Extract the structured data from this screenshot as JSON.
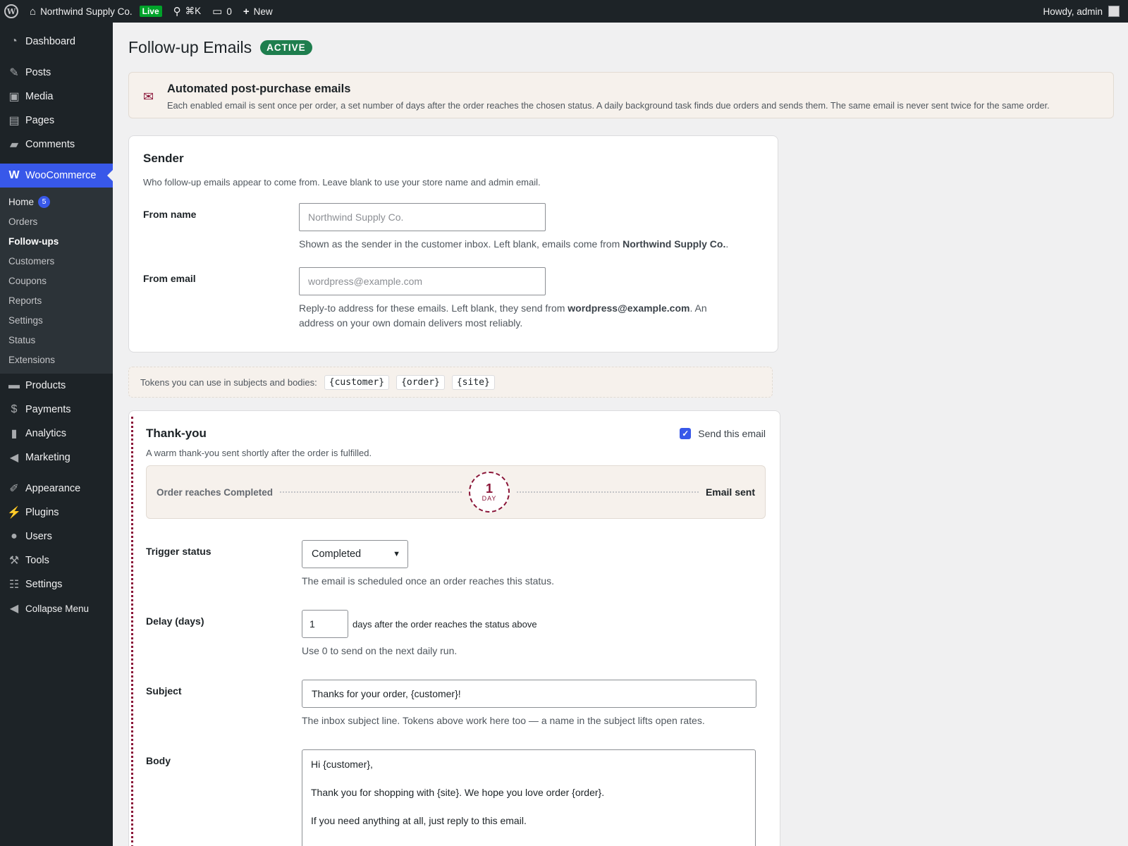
{
  "adminbar": {
    "site_name": "Northwind Supply Co.",
    "live_badge": "Live",
    "shortcut": "⌘K",
    "comments_count": "0",
    "new_label": "New",
    "howdy": "Howdy, admin"
  },
  "sidebar": {
    "top": [
      {
        "label": "Dashboard",
        "icon": "dashboard-icon"
      }
    ],
    "content": [
      {
        "label": "Posts",
        "icon": "pin-icon"
      },
      {
        "label": "Media",
        "icon": "media-icon"
      },
      {
        "label": "Pages",
        "icon": "pages-icon"
      },
      {
        "label": "Comments",
        "icon": "comment-icon"
      }
    ],
    "woocommerce": {
      "label": "WooCommerce"
    },
    "submenu": [
      {
        "label": "Home",
        "badge": "5"
      },
      {
        "label": "Orders"
      },
      {
        "label": "Follow-ups"
      },
      {
        "label": "Customers"
      },
      {
        "label": "Coupons"
      },
      {
        "label": "Reports"
      },
      {
        "label": "Settings"
      },
      {
        "label": "Status"
      },
      {
        "label": "Extensions"
      }
    ],
    "commerce": [
      {
        "label": "Products"
      },
      {
        "label": "Payments"
      },
      {
        "label": "Analytics"
      },
      {
        "label": "Marketing"
      }
    ],
    "admin": [
      {
        "label": "Appearance"
      },
      {
        "label": "Plugins"
      },
      {
        "label": "Users"
      },
      {
        "label": "Tools"
      },
      {
        "label": "Settings"
      },
      {
        "label": "Collapse Menu"
      }
    ]
  },
  "page": {
    "title": "Follow-up Emails",
    "status_badge": "ACTIVE"
  },
  "intro": {
    "title": "Automated post-purchase emails",
    "text": "Each enabled email is sent once per order, a set number of days after the order reaches the chosen status. A daily background task finds due orders and sends them. The same email is never sent twice for the same order."
  },
  "sender": {
    "title": "Sender",
    "desc": "Who follow-up emails appear to come from. Leave blank to use your store name and admin email.",
    "from_name_label": "From name",
    "from_name_placeholder": "Northwind Supply Co.",
    "from_name_help_pre": "Shown as the sender in the customer inbox. Left blank, emails come from ",
    "from_name_help_bold": "Northwind Supply Co.",
    "from_name_help_post": ".",
    "from_email_label": "From email",
    "from_email_placeholder": "wordpress@example.com",
    "from_email_help_pre": "Reply-to address for these emails. Left blank, they send from ",
    "from_email_help_bold": "wordpress@example.com",
    "from_email_help_post": ". An address on your own domain delivers most reliably."
  },
  "tokens": {
    "label": "Tokens you can use in subjects and bodies:",
    "items": [
      "{customer}",
      "{order}",
      "{site}"
    ]
  },
  "email": {
    "title": "Thank-you",
    "send_label": "Send this email",
    "send_checked": true,
    "desc": "A warm thank-you sent shortly after the order is fulfilled.",
    "timeline_start": "Order reaches Completed",
    "timeline_day_num": "1",
    "timeline_day_unit": "DAY",
    "timeline_end": "Email sent",
    "trigger_label": "Trigger status",
    "trigger_value": "Completed",
    "trigger_help": "The email is scheduled once an order reaches this status.",
    "delay_label": "Delay (days)",
    "delay_value": "1",
    "delay_suffix": "days after the order reaches the status above",
    "delay_help": "Use 0 to send on the next daily run.",
    "subject_label": "Subject",
    "subject_value": "Thanks for your order, {customer}!",
    "subject_help": "The inbox subject line. Tokens above work here too — a name in the subject lifts open rates.",
    "body_label": "Body",
    "body_lines": [
      "Hi {customer},",
      "Thank you for shopping with {site}. We hope you love order {order}.",
      "If you need anything at all, just reply to this email."
    ]
  },
  "colors": {
    "accent": "#3858e9",
    "brand_wine": "#8a1538",
    "active_green": "#1e7e4e",
    "adminbar_bg": "#1d2327"
  }
}
